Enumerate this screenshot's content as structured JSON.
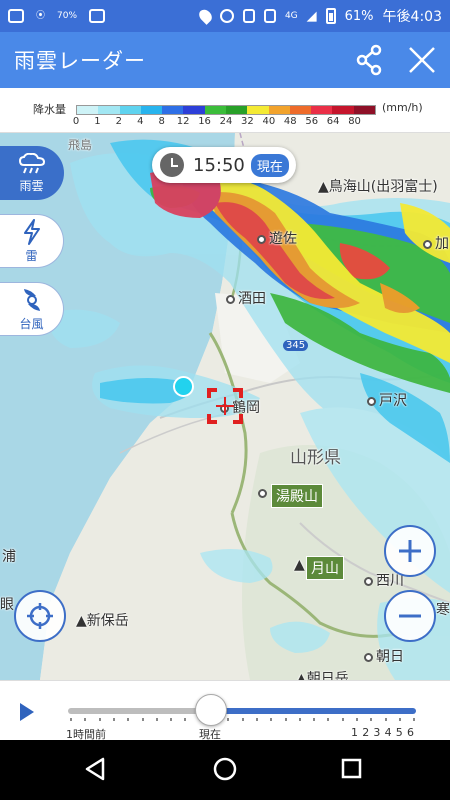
{
  "status_bar": {
    "battery_small": "70%",
    "network": "4G",
    "battery": "61%",
    "time": "午後4:03"
  },
  "app_bar": {
    "title": "雨雲レーダー"
  },
  "legend": {
    "label": "降水量",
    "unit": "(mm/h)",
    "ticks": [
      "0",
      "1",
      "2",
      "4",
      "8",
      "12",
      "16",
      "24",
      "32",
      "40",
      "48",
      "56",
      "64",
      "80"
    ],
    "colors": [
      "#cef3f7",
      "#a2e7f3",
      "#5fd3ef",
      "#28b4ee",
      "#2e6fe6",
      "#2d3fd8",
      "#3bbd3a",
      "#28a028",
      "#f4ea34",
      "#f2a32c",
      "#ee6b2a",
      "#ea2f47",
      "#c5152c",
      "#8e1027"
    ]
  },
  "time_pill": {
    "time": "15:50",
    "badge": "現在"
  },
  "side_buttons": [
    {
      "label": "雨雲",
      "icon": "rain-cloud-icon",
      "active": true
    },
    {
      "label": "雷",
      "icon": "lightning-icon",
      "active": false
    },
    {
      "label": "台風",
      "icon": "typhoon-icon",
      "active": false
    }
  ],
  "map": {
    "labels": {
      "tobishima": "飛島",
      "chokai": "鳥海山(出羽富士)",
      "yuza": "遊佐",
      "sakata": "酒田",
      "kanayama": "加",
      "route": "345",
      "tsuruoka": "鶴岡",
      "tozawa": "戸沢",
      "yamagata": "山形県",
      "yudonosan": "湯殿山",
      "gassan": "月山",
      "nishikawa": "西川",
      "ura": "浦",
      "megane": "眼",
      "shinhodake": "新保岳",
      "asahi": "朝日",
      "kan": "寒",
      "asahidake": "朝日岳"
    }
  },
  "timeline": {
    "left_label": "1時間前",
    "center_label": "現在",
    "right_numbers": [
      "1",
      "2",
      "3",
      "4",
      "5",
      "6"
    ],
    "position_fraction": 0.41
  },
  "colors": {
    "header_blue": "#4a89e8",
    "status_blue": "#3b6fd6",
    "accent_blue": "#3a6fc9"
  }
}
